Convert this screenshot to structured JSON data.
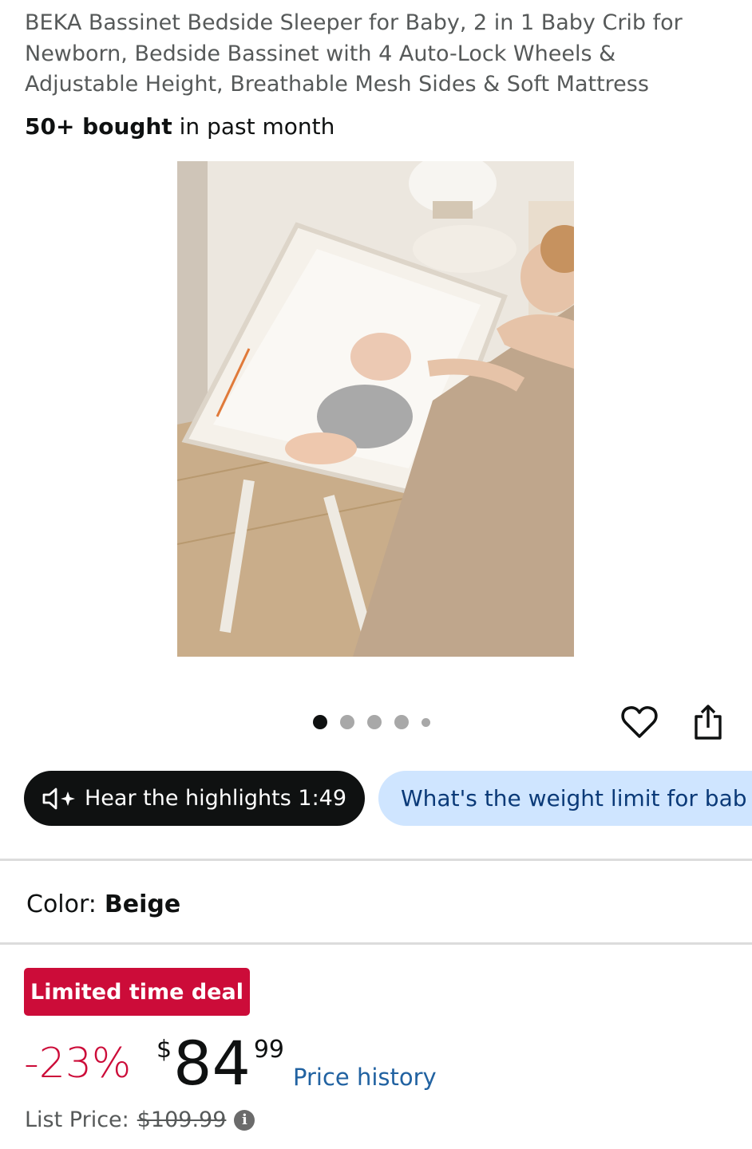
{
  "product": {
    "title": "BEKA Bassinet Bedside Sleeper for Baby, 2 in 1 Baby Crib for Newborn, Bedside Bassinet with 4 Auto-Lock Wheels & Adjustable Height, Breathable Mesh Sides & Soft Mattress",
    "bought_count": "50+ bought",
    "bought_suffix": " in past month"
  },
  "gallery": {
    "image_icon": "bassinet-product-photo",
    "image_count": 5,
    "active_index": 1
  },
  "actions": {
    "wishlist_icon": "heart-icon",
    "share_icon": "share-icon"
  },
  "chips": {
    "hear_highlights": "Hear the highlights 1:49",
    "question": "What's the weight limit for bab"
  },
  "variation": {
    "label": "Color:",
    "value": "Beige"
  },
  "deal": {
    "badge": "Limited time deal",
    "discount": "-23%",
    "currency": "$",
    "price_whole": "84",
    "price_fraction": "99",
    "price_history": "Price history",
    "list_price_label": "List Price:",
    "list_price_value": "$109.99"
  },
  "colors": {
    "deal_red": "#cc0c39",
    "link_blue": "#2162a1",
    "chip_blue_bg": "#cfe5ff"
  }
}
